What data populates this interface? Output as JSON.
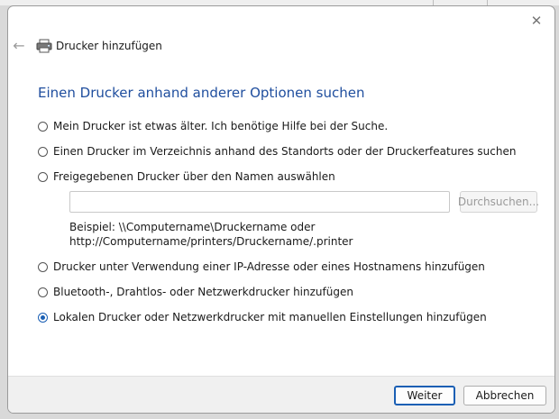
{
  "window": {
    "title": "Drucker hinzufügen",
    "close_glyph": "✕",
    "back_glyph": "←"
  },
  "main": {
    "heading": "Einen Drucker anhand anderer Optionen suchen",
    "options": [
      {
        "label": "Mein Drucker ist etwas älter. Ich benötige Hilfe bei der Suche.",
        "checked": false
      },
      {
        "label": "Einen Drucker im Verzeichnis anhand des Standorts oder der Druckerfeatures suchen",
        "checked": false
      },
      {
        "label": "Freigegebenen Drucker über den Namen auswählen",
        "checked": false
      },
      {
        "label": "Drucker unter Verwendung einer IP-Adresse oder eines Hostnamens hinzufügen",
        "checked": false
      },
      {
        "label": "Bluetooth-, Drahtlos- oder Netzwerkdrucker hinzufügen",
        "checked": false
      },
      {
        "label": "Lokalen Drucker oder Netzwerkdrucker mit manuellen Einstellungen hinzufügen",
        "checked": true
      }
    ],
    "shared_printer": {
      "input_value": "",
      "browse_label": "Durchsuchen...",
      "example_line1": "Beispiel: \\\\Computername\\Druckername oder",
      "example_line2": "http://Computername/printers/Druckername/.printer"
    }
  },
  "footer": {
    "next_label": "Weiter",
    "cancel_label": "Abbrechen"
  },
  "icons": {
    "close": "close-icon",
    "back": "back-arrow-icon",
    "printer": "printer-icon"
  },
  "colors": {
    "heading": "#1f4e9e",
    "accent": "#1a5fb4"
  }
}
